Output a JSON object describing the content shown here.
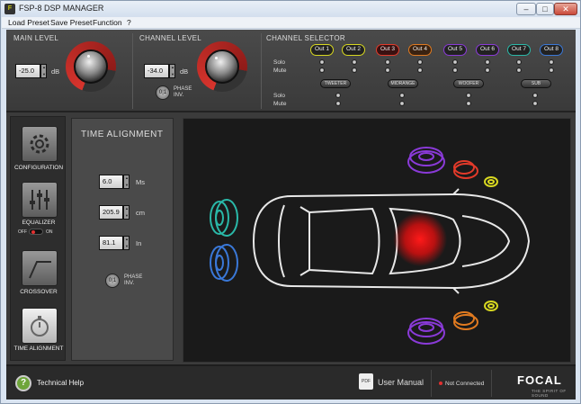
{
  "window": {
    "title": "FSP-8 DSP MANAGER",
    "minimize": "–",
    "maximize": "□",
    "close": "✕",
    "app_icon": "F"
  },
  "menu": [
    "Load Preset",
    "Save Preset",
    "Function",
    "?"
  ],
  "main_level": {
    "title": "MAIN LEVEL",
    "value": "-25.0",
    "unit": "dB"
  },
  "channel_level": {
    "title": "CHANNEL LEVEL",
    "value": "-34.0",
    "unit": "dB",
    "phase_label": "PHASE INV.",
    "phase_icon": "0|1"
  },
  "channel_selector": {
    "title": "CHANNEL SELECTOR",
    "outputs": [
      {
        "label": "Out 1",
        "color": "#d8d820"
      },
      {
        "label": "Out 2",
        "color": "#d8d820"
      },
      {
        "label": "Out 3",
        "color": "#e23a2a"
      },
      {
        "label": "Out 4",
        "color": "#e07a20"
      },
      {
        "label": "Out 5",
        "color": "#8a3ad8"
      },
      {
        "label": "Out 6",
        "color": "#8a3ad8"
      },
      {
        "label": "Out 7",
        "color": "#2ab8a8"
      },
      {
        "label": "Out 8",
        "color": "#3a78d8"
      }
    ],
    "solo_label": "Solo",
    "mute_label": "Mute",
    "groups": [
      "TWEETER",
      "MIDRANGE",
      "WOOFER",
      "SUB"
    ]
  },
  "sidebar": [
    {
      "label": "CONFIGURATION",
      "icon": "gear-icon"
    },
    {
      "label": "EQUALIZER",
      "icon": "equalizer-icon",
      "toggle_off": "OFF",
      "toggle_on": "ON"
    },
    {
      "label": "CROSSOVER",
      "icon": "crossover-icon"
    },
    {
      "label": "TIME ALIGNMENT",
      "icon": "stopwatch-icon"
    }
  ],
  "time_alignment": {
    "title": "TIME ALIGNMENT",
    "fields": [
      {
        "value": "6.0",
        "unit": "Ms"
      },
      {
        "value": "205.9",
        "unit": "cm"
      },
      {
        "value": "81.1",
        "unit": "In"
      }
    ],
    "phase_label": "PHASE INV.",
    "phase_icon": "0|1"
  },
  "footer": {
    "help_icon": "?",
    "help": "Technical Help",
    "pdf_icon": "PDF",
    "manual": "User Manual",
    "status": "Not Connected",
    "brand": "FOCAL",
    "tagline": "THE SPIRIT OF SOUND"
  }
}
